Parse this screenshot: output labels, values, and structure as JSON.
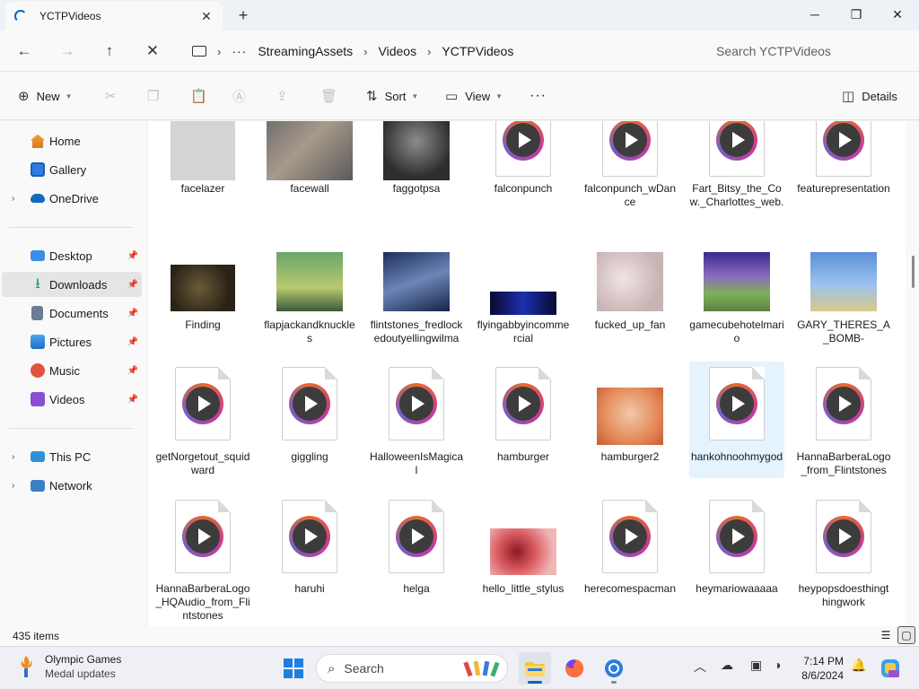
{
  "window": {
    "tab_title": "YCTPVideos",
    "tab_close": "✕",
    "new_tab": "+",
    "minimize": "─",
    "maximize": "❐",
    "close": "✕"
  },
  "address": {
    "ellipsis": "···",
    "separator": "›",
    "crumbs": [
      "StreamingAssets",
      "Videos",
      "YCTPVideos"
    ],
    "search_placeholder": "Search YCTPVideos"
  },
  "commands": {
    "new": "New",
    "sort": "Sort",
    "view": "View",
    "more": "···",
    "details": "Details"
  },
  "sidebar": {
    "items": [
      {
        "label": "Home"
      },
      {
        "label": "Gallery"
      },
      {
        "label": "OneDrive"
      },
      {
        "label": "Desktop"
      },
      {
        "label": "Downloads"
      },
      {
        "label": "Documents"
      },
      {
        "label": "Pictures"
      },
      {
        "label": "Music"
      },
      {
        "label": "Videos"
      },
      {
        "label": "This PC"
      },
      {
        "label": "Network"
      }
    ]
  },
  "files": [
    {
      "name": "facelazer"
    },
    {
      "name": "facewall"
    },
    {
      "name": "faggotpsa"
    },
    {
      "name": "falconpunch"
    },
    {
      "name": "falconpunch_wDance"
    },
    {
      "name": "Fart_Bitsy_the_Cow._Charlottes_web."
    },
    {
      "name": "featurepresentation"
    },
    {
      "name": "Finding"
    },
    {
      "name": "flapjackandknuckles"
    },
    {
      "name": "flintstones_fredlockedoutyellingwilma"
    },
    {
      "name": "flyingabbyincommercial"
    },
    {
      "name": "fucked_up_fan"
    },
    {
      "name": "gamecubehotelmario"
    },
    {
      "name": "GARY_THERES_A_BOMB-"
    },
    {
      "name": "getNorgetout_squidward"
    },
    {
      "name": "giggling"
    },
    {
      "name": "HalloweenIsMagical"
    },
    {
      "name": "hamburger"
    },
    {
      "name": "hamburger2"
    },
    {
      "name": "hankohnoohmygod"
    },
    {
      "name": "HannaBarberaLogo_from_Flintstones"
    },
    {
      "name": "HannaBarberaLogo_HQAudio_from_Flintstones"
    },
    {
      "name": "haruhi"
    },
    {
      "name": "helga"
    },
    {
      "name": "hello_little_stylus"
    },
    {
      "name": "herecomespacman"
    },
    {
      "name": "heymariowaaaaa"
    },
    {
      "name": "heypopsdoesthingthingwork"
    }
  ],
  "status": {
    "item_count": "435 items"
  },
  "taskbar": {
    "weather_title": "Olympic Games",
    "weather_sub": "Medal updates",
    "search_label": "Search",
    "time": "7:14 PM",
    "date": "8/6/2024"
  }
}
